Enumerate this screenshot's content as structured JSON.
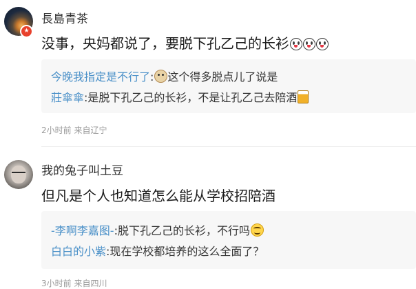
{
  "comments": [
    {
      "username": "長島青茶",
      "avatar_icon": "avatar-photo-icon",
      "badge_icon": "verified-badge-icon",
      "content": "没事，央妈都说了，要脱下孔乙己的长衫",
      "content_emojis": [
        "crying-face-icon",
        "crying-face-icon",
        "crying-face-icon"
      ],
      "replies": [
        {
          "user": "今晚我指定是不行了",
          "separator": ":",
          "emoji_before": "doge-icon",
          "text": "这个得多脱点儿了说是"
        },
        {
          "user": "莊傘傘",
          "separator": ":",
          "text": "是脱下孔乙己的长衫，不是让孔乙己去陪酒",
          "emoji_after": "beer-icon"
        }
      ],
      "time": "2小时前",
      "source": "来自辽宁"
    },
    {
      "username": "我的兔子叫土豆",
      "avatar_icon": "avatar-photo-icon",
      "content": "但凡是个人也知道怎么能从学校招陪酒",
      "replies": [
        {
          "user": "-李啊李嘉图-",
          "separator": ":",
          "text": "脱下孔乙己的长衫，不行吗",
          "emoji_after": "smile-face-icon"
        },
        {
          "user": "白白的小紫",
          "separator": ":",
          "text": "现在学校都培养的这么全面了？"
        }
      ],
      "time": "3小时前",
      "source": "来自四川"
    }
  ],
  "colors": {
    "reply_user": "#4a90c8",
    "reply_bg": "#f7f7f7",
    "meta": "#999999",
    "badge": "#e8412c"
  }
}
